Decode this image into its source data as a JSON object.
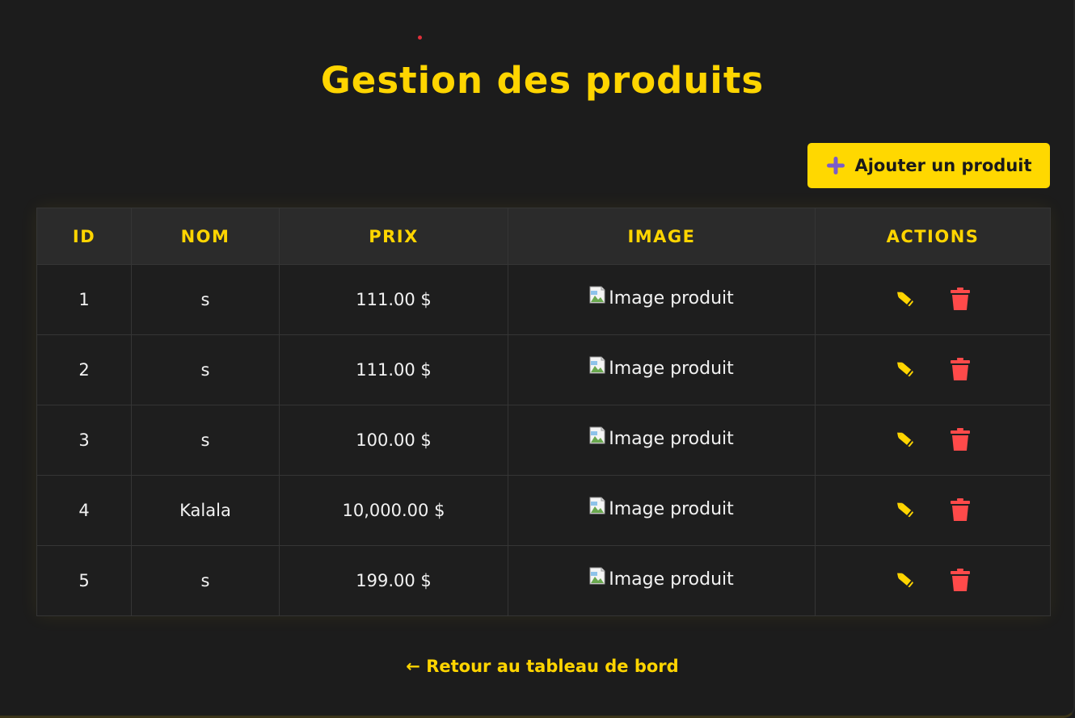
{
  "page": {
    "title": "Gestion des produits"
  },
  "toolbar": {
    "add_label": "Ajouter un produit",
    "add_icon": "plus-icon"
  },
  "table": {
    "columns": [
      "ID",
      "NOM",
      "PRIX",
      "IMAGE",
      "ACTIONS"
    ],
    "rows": [
      {
        "id": "1",
        "nom": "s",
        "prix": "111.00 $",
        "image_alt": "Image produit"
      },
      {
        "id": "2",
        "nom": "s",
        "prix": "111.00 $",
        "image_alt": "Image produit"
      },
      {
        "id": "3",
        "nom": "s",
        "prix": "100.00 $",
        "image_alt": "Image produit"
      },
      {
        "id": "4",
        "nom": "Kalala",
        "prix": "10,000.00 $",
        "image_alt": "Image produit"
      },
      {
        "id": "5",
        "nom": "s",
        "prix": "199.00 $",
        "image_alt": "Image produit"
      }
    ],
    "action_icons": {
      "edit": "pencil-icon",
      "delete": "trash-icon"
    }
  },
  "footer": {
    "back_label": "← Retour au tableau de bord"
  },
  "colors": {
    "background": "#1c1c1c",
    "accent": "#ffd500",
    "danger": "#ff4a4a",
    "header_bg": "#2b2b2b",
    "row_bg": "#1e1e1e",
    "plus_icon": "#7b5cc8"
  }
}
